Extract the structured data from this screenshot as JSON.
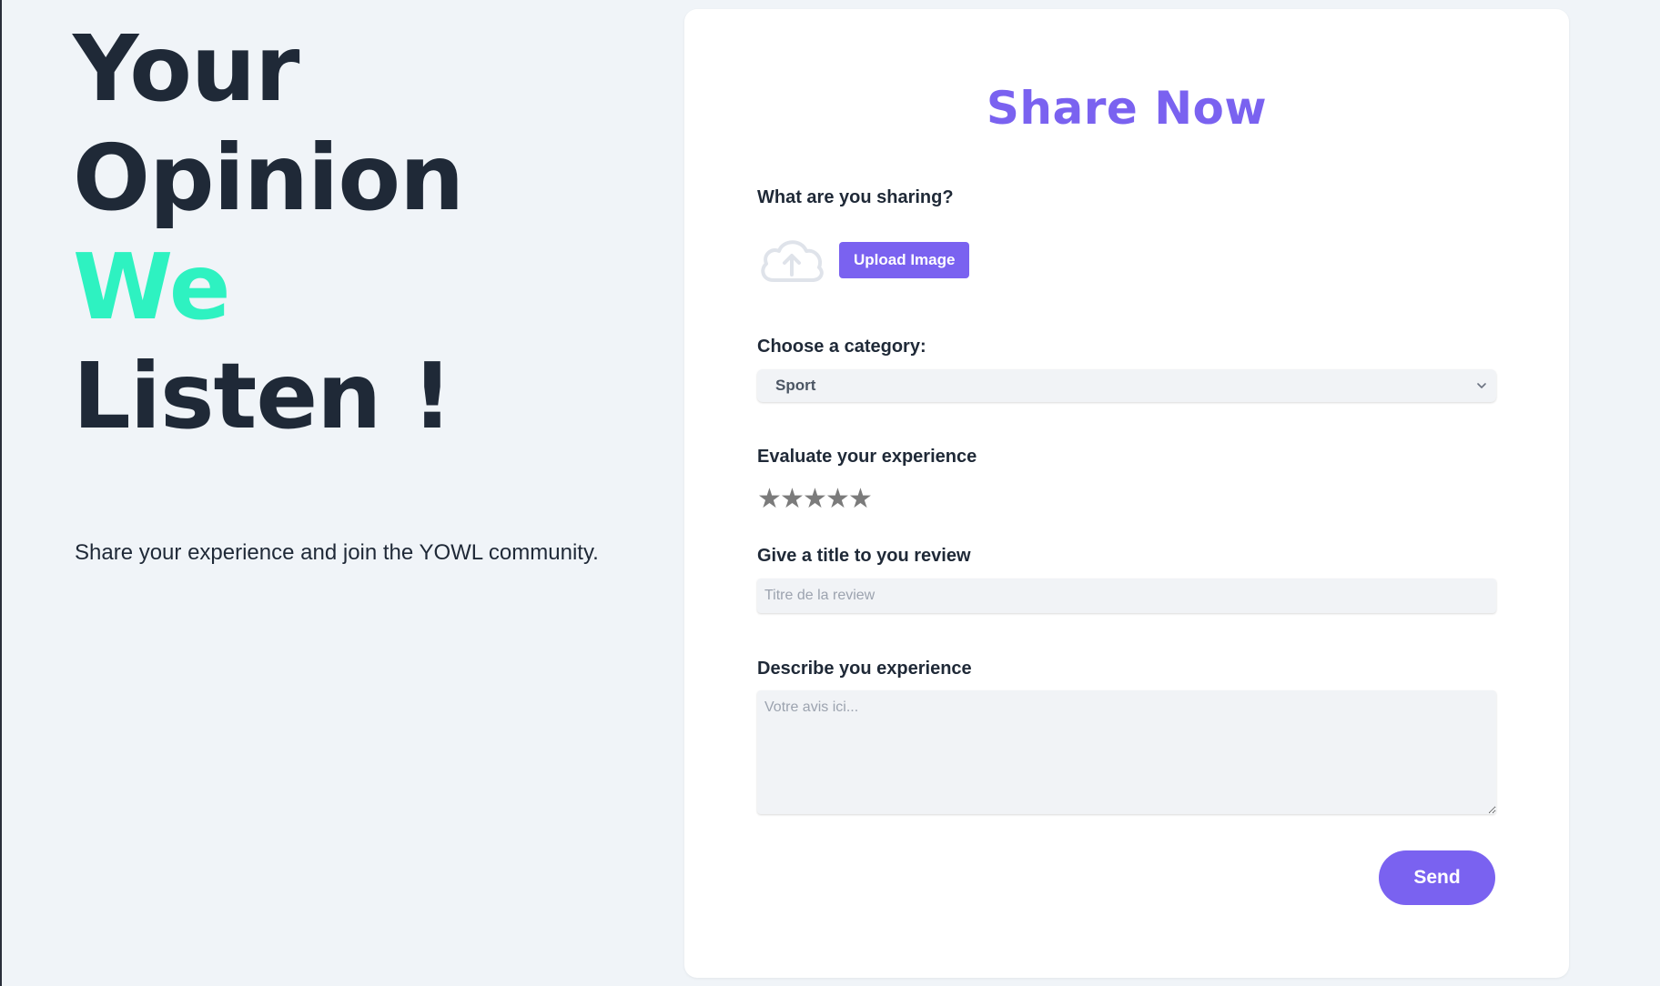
{
  "hero": {
    "line1": "Your",
    "line2": "Opinion",
    "line3": "We",
    "line4": "Listen !",
    "subtitle": "Share your experience and join the YOWL community."
  },
  "form": {
    "title": "Share Now",
    "upload_label": "What are you sharing?",
    "upload_button": "Upload Image",
    "upload_icon": "cloud-upload-icon",
    "category_label": "Choose a category:",
    "category_value": "Sport",
    "rating_label": "Evaluate your experience",
    "rating_value": 0,
    "rating_max": 5,
    "star_glyph": "★",
    "title_label": "Give a title to you review",
    "title_placeholder": "Titre de la review",
    "title_value": "",
    "description_label": "Describe you experience",
    "description_placeholder": "Votre avis ici...",
    "description_value": "",
    "send_button": "Send"
  },
  "colors": {
    "accent": "#7a62f0",
    "highlight": "#2ef2c1",
    "text": "#1f2937",
    "background": "#f0f4f8",
    "star": "#7b7b7b"
  }
}
